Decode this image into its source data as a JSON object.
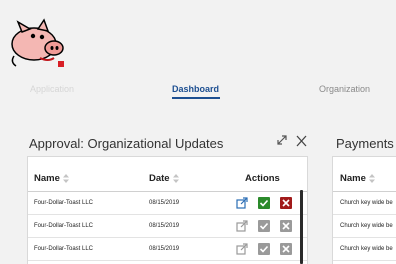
{
  "nav": {
    "items": [
      {
        "label": "Application",
        "state": "faint"
      },
      {
        "label": "Dashboard",
        "state": "active"
      },
      {
        "label": "Organization",
        "state": "muted"
      }
    ]
  },
  "approval_panel": {
    "title": "Approval: Organizational Updates",
    "columns": {
      "name": "Name",
      "date": "Date",
      "actions": "Actions"
    },
    "rows": [
      {
        "name": "Four-Dollar-Toast LLC",
        "date": "08/15/2019",
        "edit_state": "active",
        "approve_state": "active",
        "reject_state": "active"
      },
      {
        "name": "Four-Dollar-Toast LLC",
        "date": "08/15/2019",
        "edit_state": "disabled",
        "approve_state": "disabled",
        "reject_state": "disabled"
      },
      {
        "name": "Four-Dollar-Toast LLC",
        "date": "08/15/2019",
        "edit_state": "disabled",
        "approve_state": "disabled",
        "reject_state": "disabled"
      }
    ]
  },
  "payments_panel": {
    "title": "Payments",
    "columns": {
      "name": "Name"
    },
    "rows": [
      {
        "name": "Church key wide be"
      },
      {
        "name": "Church key wide be"
      },
      {
        "name": "Church key wide be"
      }
    ]
  },
  "colors": {
    "accent": "#1d4f91",
    "approve": "#2b8a2b",
    "reject": "#a11a1a",
    "disabled": "#9a9a9a",
    "edit_icon": "#2a6db5"
  },
  "icons": [
    "pig-logo-icon",
    "sort-icon",
    "edit-external-icon",
    "check-icon",
    "close-x-icon",
    "expand-icon",
    "close-icon"
  ]
}
